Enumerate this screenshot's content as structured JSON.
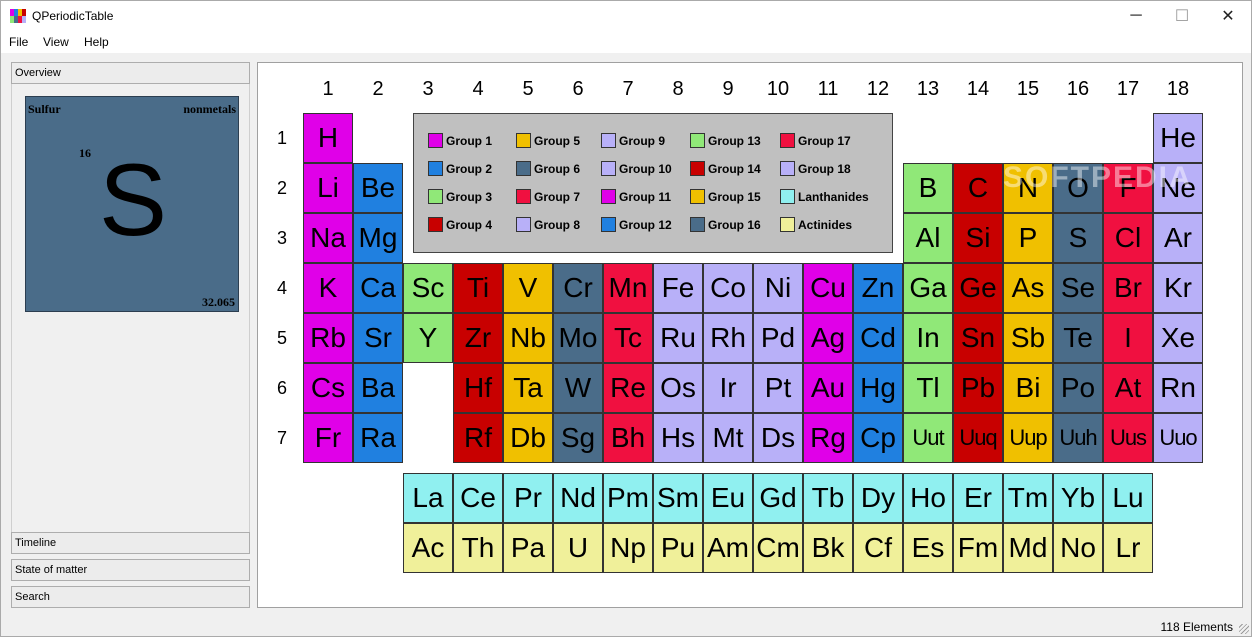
{
  "window": {
    "title": "QPeriodicTable",
    "icon": "periodic-table-icon"
  },
  "titlebar": {
    "minimize_icon": "─",
    "maximize_icon": "☐",
    "close_icon": "✕"
  },
  "menu": [
    {
      "label": "File"
    },
    {
      "label": "View"
    },
    {
      "label": "Help"
    }
  ],
  "panel": {
    "tabs": [
      {
        "label": "Overview"
      },
      {
        "label": "Timeline"
      },
      {
        "label": "State of matter"
      },
      {
        "label": "Search"
      }
    ],
    "element": {
      "name": "Sulfur",
      "category": "nonmetals",
      "number": "16",
      "symbol": "S",
      "mass": "32.065",
      "color": "#4a6c89"
    }
  },
  "table": {
    "groups": [
      "1",
      "2",
      "3",
      "4",
      "5",
      "6",
      "7",
      "8",
      "9",
      "10",
      "11",
      "12",
      "13",
      "14",
      "15",
      "16",
      "17",
      "18"
    ],
    "periods": [
      "1",
      "2",
      "3",
      "4",
      "5",
      "6",
      "7"
    ],
    "colors": {
      "1": "#e000e8",
      "2": "#2080e0",
      "3": "#90e878",
      "4": "#c80000",
      "5": "#f0c000",
      "6": "#4a6c89",
      "7": "#f01040",
      "8": "#b8b0f8",
      "9": "#b8b0f8",
      "10": "#b8b0f8",
      "11": "#e000e8",
      "12": "#2080e0",
      "13": "#90e878",
      "14": "#c80000",
      "15": "#f0c000",
      "16": "#4a6c89",
      "17": "#f01040",
      "18": "#b8b0f8",
      "L": "#90f0f0",
      "A": "#f0f09a"
    },
    "rows": [
      [
        "H",
        "",
        "",
        "",
        "",
        "",
        "",
        "",
        "",
        "",
        "",
        "",
        "",
        "",
        "",
        "",
        "",
        "He"
      ],
      [
        "Li",
        "Be",
        "",
        "",
        "",
        "",
        "",
        "",
        "",
        "",
        "",
        "",
        "B",
        "C",
        "N",
        "O",
        "F",
        "Ne"
      ],
      [
        "Na",
        "Mg",
        "",
        "",
        "",
        "",
        "",
        "",
        "",
        "",
        "",
        "",
        "Al",
        "Si",
        "P",
        "S",
        "Cl",
        "Ar"
      ],
      [
        "K",
        "Ca",
        "Sc",
        "Ti",
        "V",
        "Cr",
        "Mn",
        "Fe",
        "Co",
        "Ni",
        "Cu",
        "Zn",
        "Ga",
        "Ge",
        "As",
        "Se",
        "Br",
        "Kr"
      ],
      [
        "Rb",
        "Sr",
        "Y",
        "Zr",
        "Nb",
        "Mo",
        "Tc",
        "Ru",
        "Rh",
        "Pd",
        "Ag",
        "Cd",
        "In",
        "Sn",
        "Sb",
        "Te",
        "I",
        "Xe"
      ],
      [
        "Cs",
        "Ba",
        "",
        "Hf",
        "Ta",
        "W",
        "Re",
        "Os",
        "Ir",
        "Pt",
        "Au",
        "Hg",
        "Tl",
        "Pb",
        "Bi",
        "Po",
        "At",
        "Rn"
      ],
      [
        "Fr",
        "Ra",
        "",
        "Rf",
        "Db",
        "Sg",
        "Bh",
        "Hs",
        "Mt",
        "Ds",
        "Rg",
        "Cp",
        "Uut",
        "Uuq",
        "Uup",
        "Uuh",
        "Uus",
        "Uuo"
      ]
    ],
    "lanthanides": [
      "La",
      "Ce",
      "Pr",
      "Nd",
      "Pm",
      "Sm",
      "Eu",
      "Gd",
      "Tb",
      "Dy",
      "Ho",
      "Er",
      "Tm",
      "Yb",
      "Lu"
    ],
    "actinides": [
      "Ac",
      "Th",
      "Pa",
      "U",
      "Np",
      "Pu",
      "Am",
      "Cm",
      "Bk",
      "Cf",
      "Es",
      "Fm",
      "Md",
      "No",
      "Lr"
    ],
    "watermark": "SOFTPEDIA"
  },
  "legend": [
    {
      "label": "Group 1",
      "key": "1"
    },
    {
      "label": "Group 5",
      "key": "5"
    },
    {
      "label": "Group 9",
      "key": "9"
    },
    {
      "label": "Group 13",
      "key": "13"
    },
    {
      "label": "Group 17",
      "key": "17"
    },
    {
      "label": "Group 2",
      "key": "2"
    },
    {
      "label": "Group 6",
      "key": "6"
    },
    {
      "label": "Group 10",
      "key": "10"
    },
    {
      "label": "Group 14",
      "key": "14"
    },
    {
      "label": "Group 18",
      "key": "18"
    },
    {
      "label": "Group 3",
      "key": "3"
    },
    {
      "label": "Group 7",
      "key": "7"
    },
    {
      "label": "Group 11",
      "key": "11"
    },
    {
      "label": "Group 15",
      "key": "15"
    },
    {
      "label": "Lanthanides",
      "key": "L"
    },
    {
      "label": "Group 4",
      "key": "4"
    },
    {
      "label": "Group 8",
      "key": "8"
    },
    {
      "label": "Group 12",
      "key": "12"
    },
    {
      "label": "Group 16",
      "key": "16"
    },
    {
      "label": "Actinides",
      "key": "A"
    }
  ],
  "status": {
    "count": "118 Elements"
  }
}
